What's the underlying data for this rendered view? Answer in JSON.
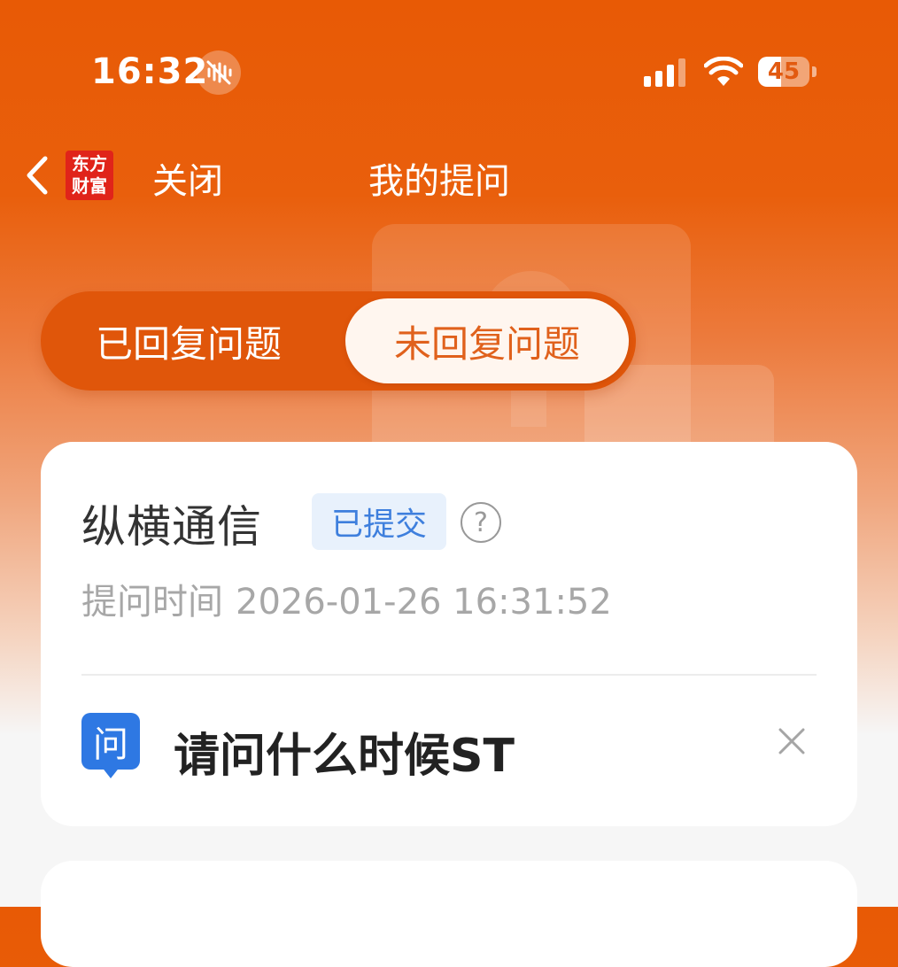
{
  "status_bar": {
    "time": "16:32",
    "battery_level": "45",
    "icons": [
      "mute-icon",
      "signal-icon",
      "wifi-icon",
      "battery-icon"
    ]
  },
  "nav": {
    "brand_line1": "东方",
    "brand_line2": "财富",
    "close_label": "关闭",
    "title": "我的提问"
  },
  "tabs": [
    {
      "label": "已回复问题",
      "active": false
    },
    {
      "label": "未回复问题",
      "active": true
    }
  ],
  "question_card": {
    "stock_name": "纵横通信",
    "status": "已提交",
    "help_symbol": "?",
    "time_label": "提问时间",
    "time_value": "2026-01-26 16:31:52",
    "q_badge": "问",
    "question": "请问什么时候ST"
  },
  "colors": {
    "brand_orange": "#e85a05",
    "active_tab_text": "#e0611c",
    "status_badge_text": "#3e7fdd",
    "status_badge_bg": "#e8f1fc",
    "question_icon": "#2e78e3"
  }
}
